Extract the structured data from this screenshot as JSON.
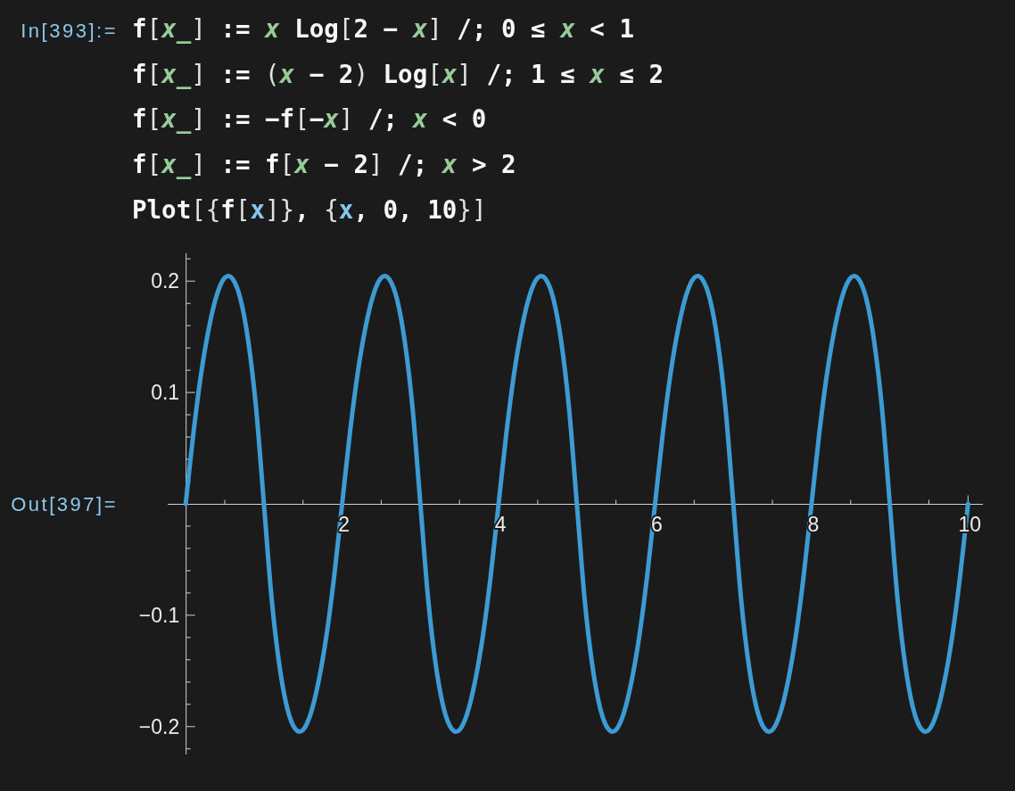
{
  "cells": [
    {
      "kind": "input",
      "label": "In[393]:=",
      "lines": [
        {
          "tokens": [
            {
              "text": "f",
              "kind": "plain"
            },
            {
              "text": "[",
              "kind": "bracket"
            },
            {
              "text": "x_",
              "kind": "pattern"
            },
            {
              "text": "]",
              "kind": "bracket"
            },
            {
              "text": " := ",
              "kind": "plain"
            },
            {
              "text": "x",
              "kind": "pattern"
            },
            {
              "text": " Log",
              "kind": "plain"
            },
            {
              "text": "[",
              "kind": "bracket"
            },
            {
              "text": "2 − ",
              "kind": "plain"
            },
            {
              "text": "x",
              "kind": "pattern"
            },
            {
              "text": "]",
              "kind": "bracket"
            },
            {
              "text": " /; 0 ≤ ",
              "kind": "plain"
            },
            {
              "text": "x",
              "kind": "pattern"
            },
            {
              "text": " < 1",
              "kind": "plain"
            }
          ]
        },
        {
          "tokens": [
            {
              "text": "f",
              "kind": "plain"
            },
            {
              "text": "[",
              "kind": "bracket"
            },
            {
              "text": "x_",
              "kind": "pattern"
            },
            {
              "text": "]",
              "kind": "bracket"
            },
            {
              "text": " := ",
              "kind": "plain"
            },
            {
              "text": "(",
              "kind": "bracket"
            },
            {
              "text": "x",
              "kind": "pattern"
            },
            {
              "text": " − 2",
              "kind": "plain"
            },
            {
              "text": ")",
              "kind": "bracket"
            },
            {
              "text": " Log",
              "kind": "plain"
            },
            {
              "text": "[",
              "kind": "bracket"
            },
            {
              "text": "x",
              "kind": "pattern"
            },
            {
              "text": "]",
              "kind": "bracket"
            },
            {
              "text": " /; 1 ≤ ",
              "kind": "plain"
            },
            {
              "text": "x",
              "kind": "pattern"
            },
            {
              "text": " ≤ 2",
              "kind": "plain"
            }
          ]
        },
        {
          "tokens": [
            {
              "text": "f",
              "kind": "plain"
            },
            {
              "text": "[",
              "kind": "bracket"
            },
            {
              "text": "x_",
              "kind": "pattern"
            },
            {
              "text": "]",
              "kind": "bracket"
            },
            {
              "text": " := −f",
              "kind": "plain"
            },
            {
              "text": "[",
              "kind": "bracket"
            },
            {
              "text": "−",
              "kind": "plain"
            },
            {
              "text": "x",
              "kind": "pattern"
            },
            {
              "text": "]",
              "kind": "bracket"
            },
            {
              "text": " /; ",
              "kind": "plain"
            },
            {
              "text": "x",
              "kind": "pattern"
            },
            {
              "text": " < 0",
              "kind": "plain"
            }
          ]
        },
        {
          "tokens": [
            {
              "text": "f",
              "kind": "plain"
            },
            {
              "text": "[",
              "kind": "bracket"
            },
            {
              "text": "x_",
              "kind": "pattern"
            },
            {
              "text": "]",
              "kind": "bracket"
            },
            {
              "text": " := f",
              "kind": "plain"
            },
            {
              "text": "[",
              "kind": "bracket"
            },
            {
              "text": "x",
              "kind": "pattern"
            },
            {
              "text": " − 2",
              "kind": "plain"
            },
            {
              "text": "]",
              "kind": "bracket"
            },
            {
              "text": " /; ",
              "kind": "plain"
            },
            {
              "text": "x",
              "kind": "pattern"
            },
            {
              "text": " > 2",
              "kind": "plain"
            }
          ]
        },
        {
          "tokens": [
            {
              "text": "Plot",
              "kind": "plain"
            },
            {
              "text": "[{",
              "kind": "bracket"
            },
            {
              "text": "f",
              "kind": "plain"
            },
            {
              "text": "[",
              "kind": "bracket"
            },
            {
              "text": "x",
              "kind": "local"
            },
            {
              "text": "]}",
              "kind": "bracket"
            },
            {
              "text": ", ",
              "kind": "plain"
            },
            {
              "text": "{",
              "kind": "bracket"
            },
            {
              "text": "x",
              "kind": "local"
            },
            {
              "text": ", 0, 10",
              "kind": "plain"
            },
            {
              "text": "}]",
              "kind": "bracket"
            }
          ]
        }
      ]
    },
    {
      "kind": "output",
      "label": "Out[397]=",
      "chart_data": {
        "type": "line",
        "xlim": [
          -0.23,
          10.19
        ],
        "ylim": [
          -0.225,
          0.225
        ],
        "xticks": [
          2,
          4,
          6,
          8,
          10
        ],
        "yticks": [
          {
            "value": -0.2,
            "label": "−0.2"
          },
          {
            "value": -0.1,
            "label": "−0.1"
          },
          0.1,
          0.2
        ],
        "x": [
          0,
          0.1,
          0.2,
          0.3,
          0.4,
          0.5,
          0.6,
          0.7,
          0.8,
          0.9,
          1,
          1.1,
          1.2,
          1.3,
          1.4,
          1.5,
          1.6,
          1.7,
          1.8,
          1.9,
          2,
          2.1,
          2.2,
          2.3,
          2.4,
          2.5,
          2.6,
          2.7,
          2.8,
          2.9,
          3,
          3.1,
          3.2,
          3.3,
          3.4,
          3.5,
          3.6,
          3.7,
          3.8,
          3.9,
          4,
          4.1,
          4.2,
          4.3,
          4.4,
          4.5,
          4.6,
          4.7,
          4.8,
          4.9,
          5,
          5.1,
          5.2,
          5.3,
          5.4,
          5.5,
          5.6,
          5.7,
          5.8,
          5.9,
          6,
          6.1,
          6.2,
          6.3,
          6.4,
          6.5,
          6.6,
          6.7,
          6.8,
          6.9,
          7,
          7.1,
          7.2,
          7.3,
          7.4,
          7.5,
          7.6,
          7.7,
          7.8,
          7.9,
          8,
          8.1,
          8.2,
          8.3,
          8.4,
          8.5,
          8.6,
          8.7,
          8.8,
          8.9,
          9,
          9.1,
          9.2,
          9.3,
          9.4,
          9.5,
          9.6,
          9.7,
          9.8,
          9.9,
          10
        ],
        "values": [
          0,
          0.064,
          0.118,
          0.159,
          0.188,
          0.203,
          0.202,
          0.184,
          0.146,
          0.086,
          0,
          -0.086,
          -0.146,
          -0.184,
          -0.202,
          -0.203,
          -0.188,
          -0.159,
          -0.118,
          -0.064,
          0,
          0.064,
          0.118,
          0.159,
          0.188,
          0.203,
          0.202,
          0.184,
          0.146,
          0.086,
          0,
          -0.086,
          -0.146,
          -0.184,
          -0.202,
          -0.203,
          -0.188,
          -0.159,
          -0.118,
          -0.064,
          0,
          0.064,
          0.118,
          0.159,
          0.188,
          0.203,
          0.202,
          0.184,
          0.146,
          0.086,
          0,
          -0.086,
          -0.146,
          -0.184,
          -0.202,
          -0.203,
          -0.188,
          -0.159,
          -0.118,
          -0.064,
          0,
          0.064,
          0.118,
          0.159,
          0.188,
          0.203,
          0.202,
          0.184,
          0.146,
          0.086,
          0,
          -0.086,
          -0.146,
          -0.184,
          -0.202,
          -0.203,
          -0.188,
          -0.159,
          -0.118,
          -0.064,
          0,
          0.064,
          0.118,
          0.159,
          0.188,
          0.203,
          0.202,
          0.184,
          0.146,
          0.086,
          0,
          -0.086,
          -0.146,
          -0.184,
          -0.202,
          -0.203,
          -0.188,
          -0.159,
          -0.118,
          -0.064,
          0
        ]
      }
    }
  ]
}
